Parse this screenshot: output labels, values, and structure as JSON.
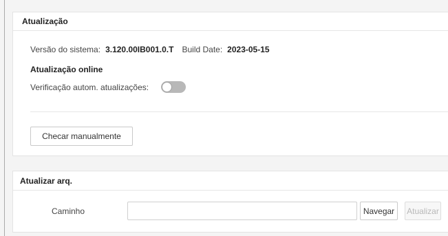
{
  "update_panel": {
    "title": "Atualização",
    "version_label": "Versão do sistema:",
    "version_value": "3.120.00IB001.0.T",
    "build_label": "Build Date:",
    "build_value": "2023-05-15",
    "online_title": "Atualização online",
    "auto_check_label": "Verificação autom. atualizações:",
    "auto_check_enabled": false,
    "check_button": "Checar manualmente"
  },
  "file_panel": {
    "title": "Atualizar arq.",
    "path_label": "Caminho",
    "path_value": "",
    "browse_button": "Navegar",
    "upload_button": "Atualizar",
    "upload_enabled": false
  },
  "colors": {
    "toggle_off": "#b8b8b8",
    "panel_bg": "#ffffff",
    "page_bg": "#f4f4f4"
  }
}
